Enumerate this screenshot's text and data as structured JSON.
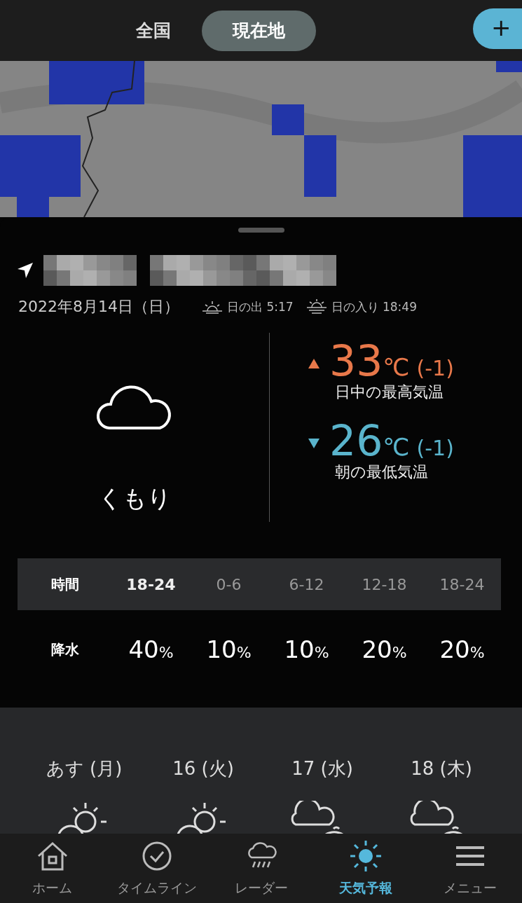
{
  "top_tabs": [
    {
      "label": "全国",
      "selected": false
    },
    {
      "label": "現在地",
      "selected": true
    }
  ],
  "add_button": {
    "label": "+"
  },
  "location": {
    "date": "2022年8月14日（日）",
    "sunrise": "日の出 5:17",
    "sunset": "日の入り 18:49"
  },
  "today": {
    "weather": {
      "kind": "cloudy",
      "label": "くもり"
    },
    "temps": [
      {
        "kind": "high",
        "value": "33",
        "unit": "℃",
        "diff": "(-1)",
        "label": "日中の最高気温"
      },
      {
        "kind": "low",
        "value": "26",
        "unit": "℃",
        "diff": "(-1)",
        "label": "朝の最低気温"
      }
    ]
  },
  "precip_table": {
    "header_label": "時間",
    "row_label": "降水",
    "slots": [
      {
        "time": "18-24",
        "value": "40",
        "unit": "%",
        "selected": true
      },
      {
        "time": "0-6",
        "value": "10",
        "unit": "%",
        "selected": false
      },
      {
        "time": "6-12",
        "value": "10",
        "unit": "%",
        "selected": false
      },
      {
        "time": "12-18",
        "value": "20",
        "unit": "%",
        "selected": false
      },
      {
        "time": "18-24",
        "value": "20",
        "unit": "%",
        "selected": false
      }
    ]
  },
  "forecast": [
    {
      "day": "あす (月)",
      "kind": "sun-cloud"
    },
    {
      "day": "16 (火)",
      "kind": "sun-cloud"
    },
    {
      "day": "17 (水)",
      "kind": "clouds"
    },
    {
      "day": "18 (木)",
      "kind": "clouds"
    }
  ],
  "nav": [
    {
      "label": "ホーム",
      "kind": "home",
      "selected": false
    },
    {
      "label": "タイムライン",
      "kind": "check",
      "selected": false
    },
    {
      "label": "レーダー",
      "kind": "rain",
      "selected": false
    },
    {
      "label": "天気予報",
      "kind": "sun",
      "selected": true
    },
    {
      "label": "メニュー",
      "kind": "menu",
      "selected": false
    }
  ]
}
